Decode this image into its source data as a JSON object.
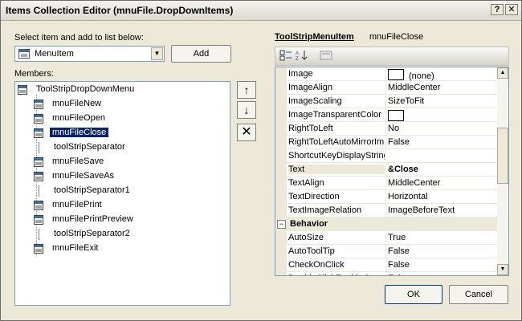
{
  "window": {
    "title": "Items Collection Editor (mnuFile.DropDownItems)",
    "help_label": "?",
    "close_label": "✕"
  },
  "select_label": "Select item and add to list below:",
  "item_type": {
    "value": "MenuItem"
  },
  "add_label": "Add",
  "members_label": "Members:",
  "tree": {
    "root": "ToolStripDropDownMenu",
    "items": [
      {
        "label": "mnuFileNew",
        "kind": "menu"
      },
      {
        "label": "mnuFileOpen",
        "kind": "menu"
      },
      {
        "label": "mnuFileClose",
        "kind": "menu",
        "selected": true
      },
      {
        "label": "toolStripSeparator",
        "kind": "sep"
      },
      {
        "label": "mnuFileSave",
        "kind": "menu"
      },
      {
        "label": "mnuFileSaveAs",
        "kind": "menu"
      },
      {
        "label": "toolStripSeparator1",
        "kind": "sep"
      },
      {
        "label": "mnuFilePrint",
        "kind": "menu"
      },
      {
        "label": "mnuFilePrintPreview",
        "kind": "menu"
      },
      {
        "label": "toolStripSeparator2",
        "kind": "sep"
      },
      {
        "label": "mnuFileExit",
        "kind": "menu"
      }
    ]
  },
  "side_buttons": {
    "up": "↑",
    "down": "↓",
    "remove": "✕"
  },
  "properties": {
    "type_label": "ToolStripMenuItem",
    "object_name": "mnuFileClose",
    "rows": [
      {
        "name": "Image",
        "value": "(none)",
        "swatch": true
      },
      {
        "name": "ImageAlign",
        "value": "MiddleCenter"
      },
      {
        "name": "ImageScaling",
        "value": "SizeToFit"
      },
      {
        "name": "ImageTransparentColor",
        "value": "",
        "swatch": true
      },
      {
        "name": "RightToLeft",
        "value": "No"
      },
      {
        "name": "RightToLeftAutoMirrorIm",
        "value": "False"
      },
      {
        "name": "ShortcutKeyDisplayString",
        "value": ""
      },
      {
        "name": "Text",
        "value": "&Close",
        "selected": true
      },
      {
        "name": "TextAlign",
        "value": "MiddleCenter"
      },
      {
        "name": "TextDirection",
        "value": "Horizontal"
      },
      {
        "name": "TextImageRelation",
        "value": "ImageBeforeText"
      },
      {
        "name": "Behavior",
        "category": true,
        "toggle": "−"
      },
      {
        "name": "AutoSize",
        "value": "True"
      },
      {
        "name": "AutoToolTip",
        "value": "False"
      },
      {
        "name": "CheckOnClick",
        "value": "False"
      },
      {
        "name": "DoubleClickEnabled",
        "value": "False"
      }
    ]
  },
  "ok_label": "OK",
  "cancel_label": "Cancel"
}
